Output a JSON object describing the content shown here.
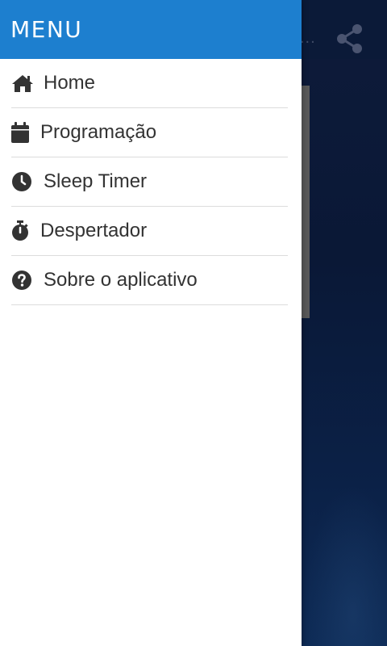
{
  "background_app": {
    "title_fragment": "...",
    "share_icon": "share-icon"
  },
  "drawer": {
    "title": "MENU",
    "header_color": "#1d7fcf",
    "items": [
      {
        "label": "Home",
        "icon": "home-icon"
      },
      {
        "label": "Programação",
        "icon": "calendar-icon"
      },
      {
        "label": "Sleep Timer",
        "icon": "clock-icon"
      },
      {
        "label": "Despertador",
        "icon": "stopwatch-icon"
      },
      {
        "label": "Sobre o aplicativo",
        "icon": "help-icon"
      }
    ]
  }
}
